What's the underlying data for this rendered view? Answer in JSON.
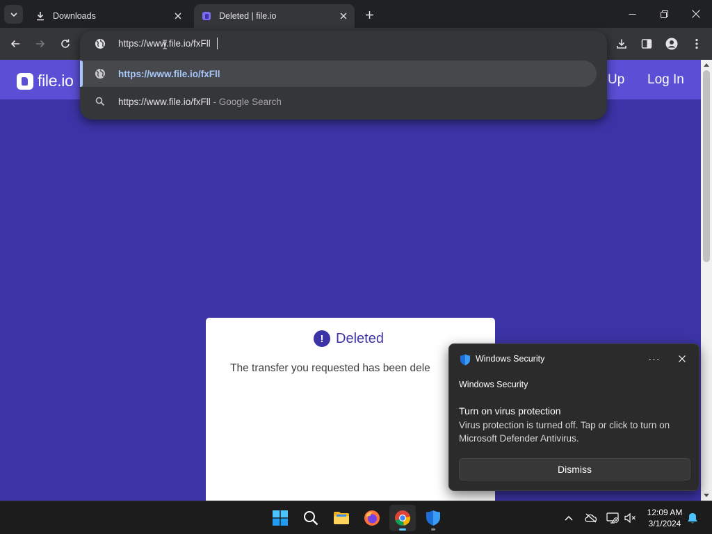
{
  "browser": {
    "tabs": [
      {
        "title": "Downloads",
        "active": false,
        "icon": "download-icon"
      },
      {
        "title": "Deleted | file.io",
        "active": true,
        "icon": "fileio-icon"
      }
    ],
    "address_bar": {
      "typed_text": "https://www.file.io/fxFll"
    },
    "suggestions": [
      {
        "icon": "globe-icon",
        "text": "https://www.file.io/fxFll",
        "suffix": ""
      },
      {
        "icon": "search-icon",
        "text": "https://www.file.io/fxFll",
        "suffix": " - Google Search"
      }
    ]
  },
  "site": {
    "logo_text": "file.io",
    "nav_signup_partial": "Up",
    "nav_login": "Log In",
    "card": {
      "title": "Deleted",
      "message": "The transfer you requested has been dele"
    }
  },
  "toast": {
    "app_name": "Windows Security",
    "attribution": "Windows Security",
    "title": "Turn on virus protection",
    "body": "Virus protection is turned off. Tap or click to turn on Microsoft Defender Antivirus.",
    "dismiss_label": "Dismiss",
    "more_label": "···"
  },
  "taskbar": {
    "time": "12:09 AM",
    "date": "3/1/2024"
  },
  "colors": {
    "page_bg": "#3c34a6",
    "site_header": "#5b4fd6",
    "accent_link": "#a8c7fa",
    "chrome_dark": "#202124",
    "toolbar": "#35363a"
  }
}
